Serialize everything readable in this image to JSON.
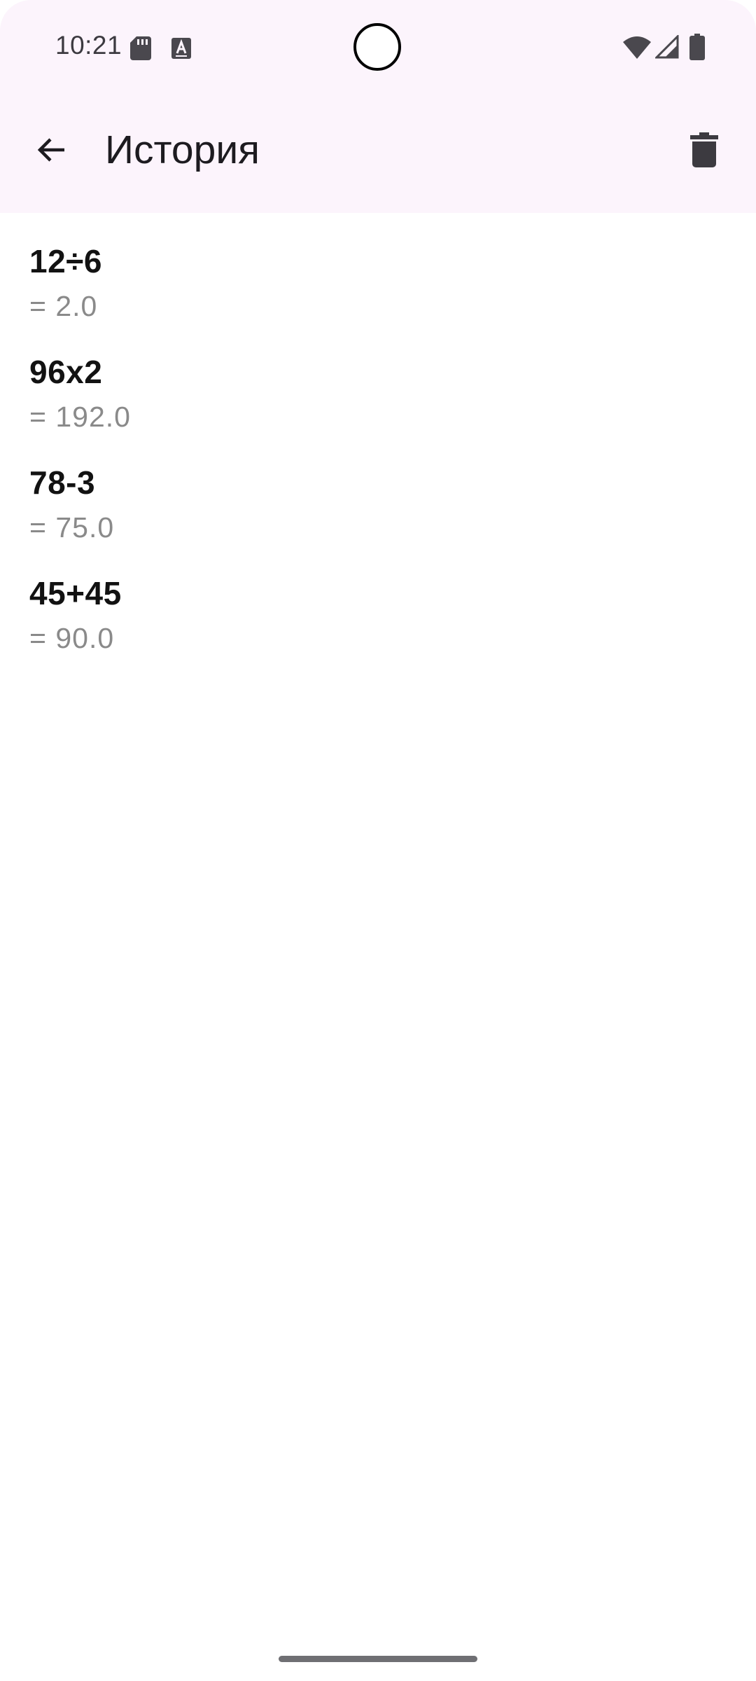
{
  "status_bar": {
    "time": "10:21",
    "icons": [
      "sd-card-icon",
      "a-notification-icon",
      "wifi-icon",
      "signal-icon",
      "battery-icon"
    ]
  },
  "app_bar": {
    "title": "История",
    "back_icon": "arrow-back-icon",
    "delete_icon": "trash-icon"
  },
  "history": {
    "items": [
      {
        "expression": "12÷6",
        "result": "= 2.0"
      },
      {
        "expression": "96x2",
        "result": "= 192.0"
      },
      {
        "expression": "78-3",
        "result": "= 75.0"
      },
      {
        "expression": "45+45",
        "result": "= 90.0"
      }
    ]
  },
  "colors": {
    "app_bar_background": "#fcf4fc",
    "expression_text": "#121212",
    "result_text": "#8a8a8a",
    "icon": "#3c3a40"
  }
}
